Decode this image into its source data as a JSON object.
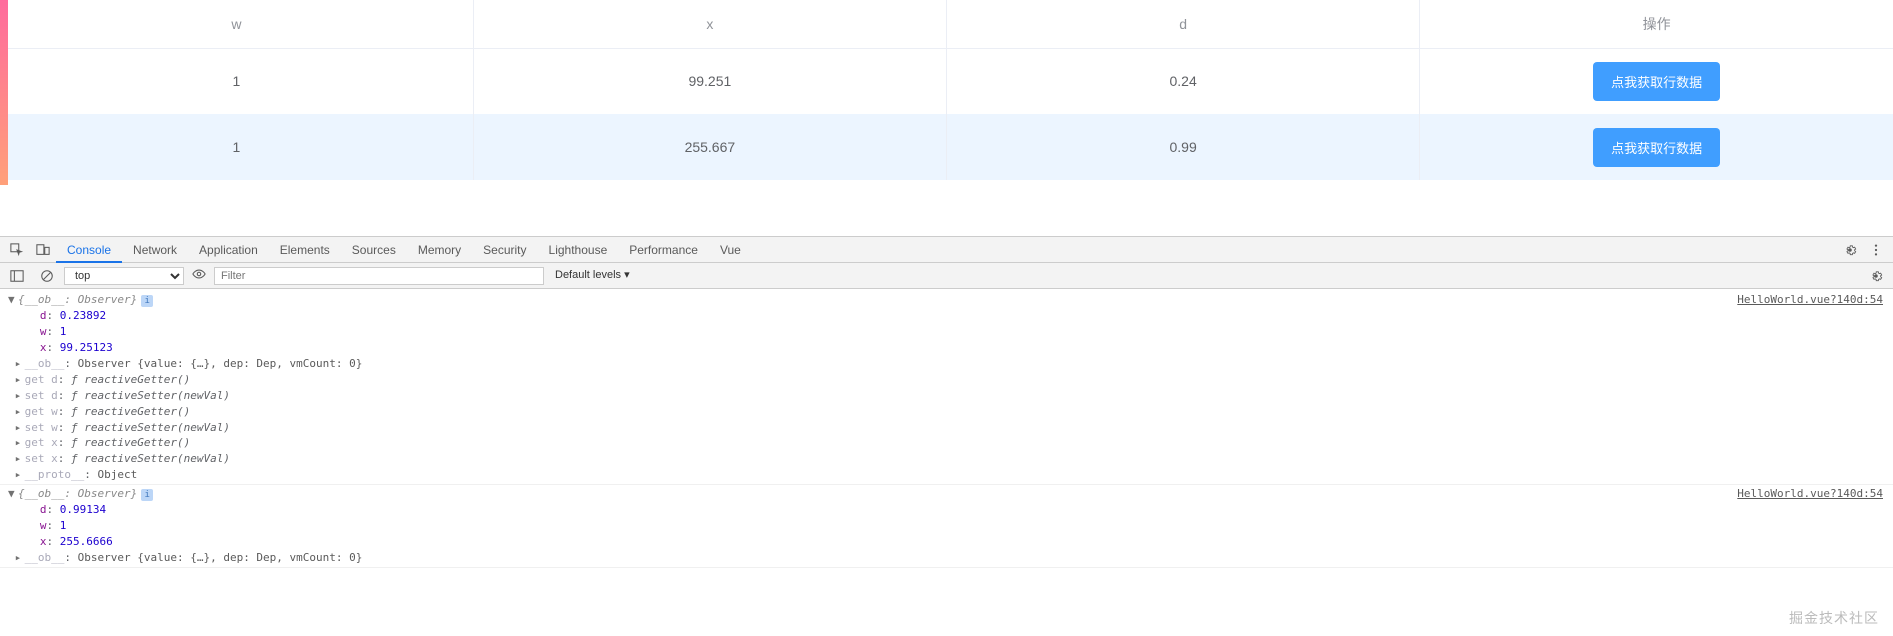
{
  "table": {
    "headers": [
      "w",
      "x",
      "d",
      "操作"
    ],
    "rows": [
      {
        "w": "1",
        "x": "99.251",
        "d": "0.24",
        "action": "点我获取行数据"
      },
      {
        "w": "1",
        "x": "255.667",
        "d": "0.99",
        "action": "点我获取行数据"
      }
    ]
  },
  "devtools": {
    "tabs": [
      "Console",
      "Network",
      "Application",
      "Elements",
      "Sources",
      "Memory",
      "Security",
      "Lighthouse",
      "Performance",
      "Vue"
    ],
    "active_tab": "Console",
    "context": "top",
    "filter_placeholder": "Filter",
    "levels": "Default levels ▾"
  },
  "console": {
    "source_link": "HelloWorld.vue?140d:54",
    "logs": [
      {
        "header": "{__ob__: Observer}",
        "props": [
          {
            "key": "d",
            "val": "0.23892",
            "type": "num"
          },
          {
            "key": "w",
            "val": "1",
            "type": "num"
          },
          {
            "key": "x",
            "val": "99.25123",
            "type": "num"
          }
        ],
        "accessors": [
          {
            "key": "__ob__",
            "val": "Observer {value: {…}, dep: Dep, vmCount: 0}",
            "caret": true,
            "style": "preview"
          },
          {
            "key": "get d",
            "val": "ƒ reactiveGetter()",
            "caret": true,
            "style": "fn"
          },
          {
            "key": "set d",
            "val": "ƒ reactiveSetter(newVal)",
            "caret": true,
            "style": "fn"
          },
          {
            "key": "get w",
            "val": "ƒ reactiveGetter()",
            "caret": true,
            "style": "fn"
          },
          {
            "key": "set w",
            "val": "ƒ reactiveSetter(newVal)",
            "caret": true,
            "style": "fn"
          },
          {
            "key": "get x",
            "val": "ƒ reactiveGetter()",
            "caret": true,
            "style": "fn"
          },
          {
            "key": "set x",
            "val": "ƒ reactiveSetter(newVal)",
            "caret": true,
            "style": "fn"
          },
          {
            "key": "__proto__",
            "val": "Object",
            "caret": true,
            "style": "preview"
          }
        ]
      },
      {
        "header": "{__ob__: Observer}",
        "props": [
          {
            "key": "d",
            "val": "0.99134",
            "type": "num"
          },
          {
            "key": "w",
            "val": "1",
            "type": "num"
          },
          {
            "key": "x",
            "val": "255.6666",
            "type": "num"
          }
        ],
        "accessors": [
          {
            "key": "__ob__",
            "val": "Observer {value: {…}, dep: Dep, vmCount: 0}",
            "caret": true,
            "style": "preview"
          }
        ]
      }
    ]
  },
  "watermark": "掘金技术社区"
}
